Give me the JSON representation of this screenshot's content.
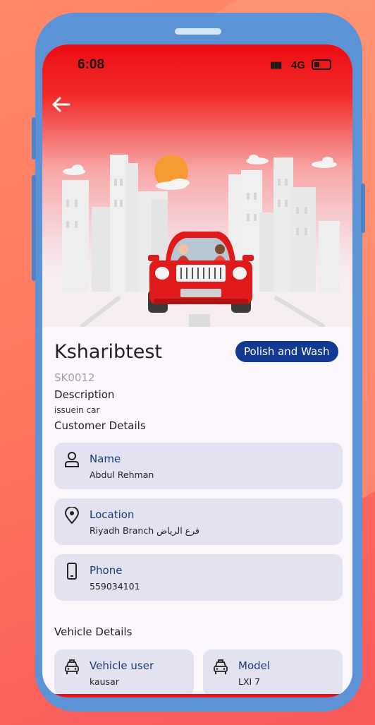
{
  "status_bar": {
    "time": "6:08",
    "network": "4G"
  },
  "job": {
    "title": "Ksharibtest",
    "service_badge": "Polish and Wash",
    "code": "SK0012",
    "description_label": "Description",
    "description_value": "issuein  car",
    "customer_details_label": "Customer Details"
  },
  "customer": {
    "name_label": "Name",
    "name_value": "Abdul Rehman",
    "location_label": "Location",
    "location_value": "Riyadh Branch فرع الرياض",
    "phone_label": "Phone",
    "phone_value": "559034101"
  },
  "vehicle": {
    "section_label": "Vehicle Details",
    "user_label": "Vehicle user",
    "user_value": "kausar",
    "model_label": "Model",
    "model_value": "LXI 7"
  },
  "icons": {
    "back": "arrow-left-icon",
    "person": "person-icon",
    "location": "location-pin-icon",
    "phone": "phone-icon",
    "car": "car-icon"
  },
  "colors": {
    "header_red": "#ec0d14",
    "badge_blue": "#123a93",
    "card_bg": "#e3e2f0",
    "label_blue": "#1b3a7a",
    "phone_frame": "#5b93d6"
  }
}
